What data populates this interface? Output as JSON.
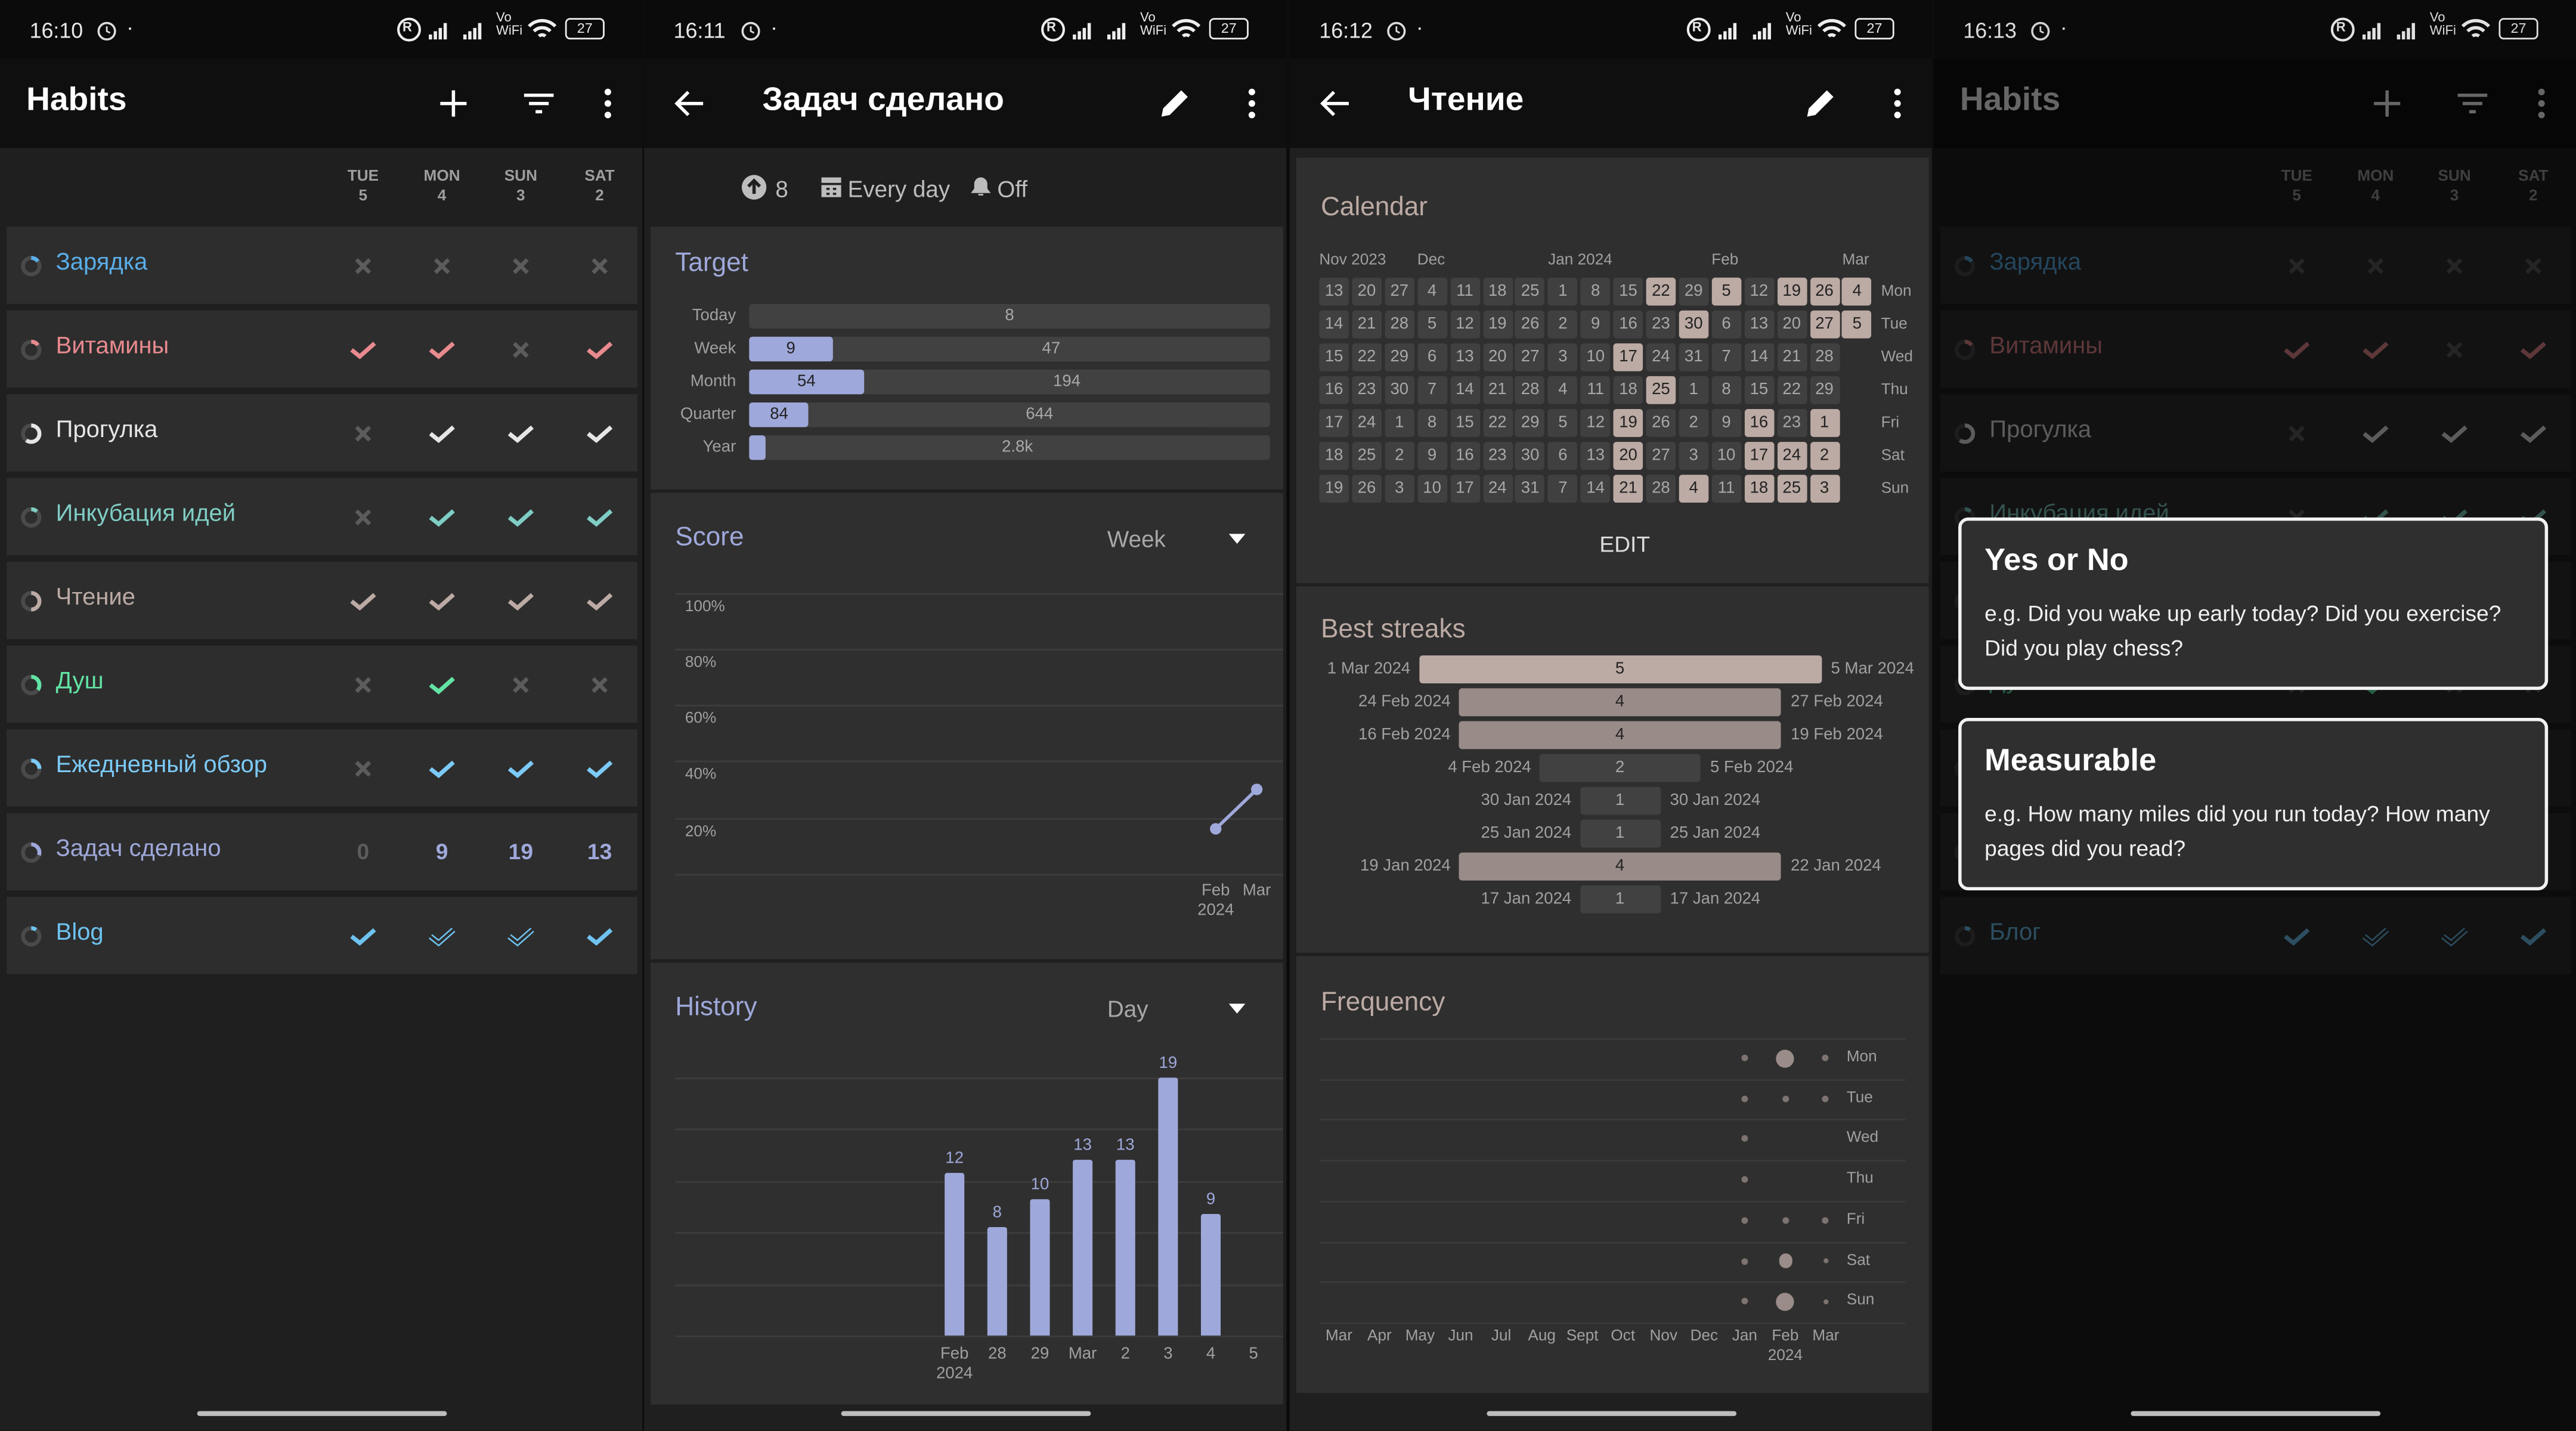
{
  "status_bars": [
    {
      "time": "16:10"
    },
    {
      "time": "16:11"
    },
    {
      "time": "16:12"
    },
    {
      "time": "16:13"
    }
  ],
  "status_icons": {
    "roaming": "R",
    "vo": "Vo",
    "wifi_label": "WiFi",
    "battery": "27"
  },
  "habits_screen": {
    "title": "Habits",
    "toolbar_icons": [
      "plus-icon",
      "filter-icon",
      "more-vert-icon"
    ],
    "day_headers": [
      {
        "dow": "TUE",
        "day": "5"
      },
      {
        "dow": "MON",
        "day": "4"
      },
      {
        "dow": "SUN",
        "day": "3"
      },
      {
        "dow": "SAT",
        "day": "2"
      }
    ],
    "habits": [
      {
        "name": "Зарядка",
        "color": "#5aaee8",
        "score": 0.15,
        "values": [
          "x",
          "x",
          "x",
          "x"
        ]
      },
      {
        "name": "Витамины",
        "color": "#e88a8f",
        "score": 0.15,
        "values": [
          "check",
          "check",
          "x",
          "check"
        ]
      },
      {
        "name": "Прогулка",
        "color": "#e6e6e6",
        "score": 0.6,
        "values": [
          "x",
          "check",
          "check",
          "check"
        ]
      },
      {
        "name": "Инкубация идей",
        "color": "#7fcdc4",
        "score": 0.12,
        "values": [
          "x",
          "check",
          "check",
          "check"
        ]
      },
      {
        "name": "Чтение",
        "color": "#bcaaa4",
        "score": 0.5,
        "values": [
          "check",
          "check",
          "check",
          "check"
        ]
      },
      {
        "name": "Душ",
        "color": "#62e3a4",
        "score": 0.35,
        "values": [
          "x",
          "check",
          "x",
          "x"
        ]
      },
      {
        "name": "Ежедневный обзор",
        "color": "#7ccaf7",
        "score": 0.25,
        "values": [
          "x",
          "check",
          "check",
          "check"
        ]
      },
      {
        "name": "Задач сделано",
        "color": "#9fa8da",
        "score": 0.3,
        "values": [
          "0",
          "9",
          "19",
          "13"
        ]
      },
      {
        "name": "Blog",
        "color": "#6ec3f0",
        "score": 0.1,
        "values": [
          "check",
          "check-outline",
          "check-outline",
          "check"
        ]
      }
    ]
  },
  "detail_screen": {
    "title": "Задач сделано",
    "accent": "#9fa8da",
    "subheader": {
      "target": "8",
      "frequency": "Every day",
      "reminder": "Off"
    },
    "target": {
      "title": "Target",
      "rows": [
        {
          "label": "Today",
          "done": "",
          "target": "8",
          "progress": 0.0
        },
        {
          "label": "Week",
          "done": "9",
          "target": "47",
          "progress": 0.16
        },
        {
          "label": "Month",
          "done": "54",
          "target": "194",
          "progress": 0.22
        },
        {
          "label": "Quarter",
          "done": "84",
          "target": "644",
          "progress": 0.115
        },
        {
          "label": "Year",
          "done": "",
          "target": "2.8k",
          "progress": 0.03
        }
      ]
    },
    "score_chart": {
      "title": "Score",
      "period": "Week",
      "chart_data": {
        "type": "line",
        "y_ticks": [
          "100%",
          "80%",
          "60%",
          "40%",
          "20%"
        ],
        "ylim": [
          0,
          100
        ],
        "x": [
          {
            "label": "Feb",
            "sub": "2024"
          },
          {
            "label": "Mar",
            "sub": ""
          }
        ],
        "values": [
          16,
          30
        ],
        "grid": true
      }
    },
    "history_chart": {
      "title": "History",
      "period": "Day",
      "chart_data": {
        "type": "bar",
        "categories": [
          {
            "label": "Feb",
            "sub": "2024"
          },
          {
            "label": "28",
            "sub": ""
          },
          {
            "label": "29",
            "sub": ""
          },
          {
            "label": "Mar",
            "sub": ""
          },
          {
            "label": "2",
            "sub": ""
          },
          {
            "label": "3",
            "sub": ""
          },
          {
            "label": "4",
            "sub": ""
          },
          {
            "label": "5",
            "sub": ""
          }
        ],
        "values": [
          12,
          8,
          10,
          13,
          13,
          19,
          9,
          null
        ],
        "ylim": [
          0,
          19
        ],
        "grid": true
      }
    }
  },
  "reading_screen": {
    "title": "Чтение",
    "accent": "#bcaaa4",
    "calendar": {
      "title": "Calendar",
      "edit_label": "EDIT",
      "weekdays": [
        "Mon",
        "Tue",
        "Wed",
        "Thu",
        "Fri",
        "Sat",
        "Sun"
      ],
      "month_labels": [
        {
          "label": "Nov 2023",
          "week": 0
        },
        {
          "label": "Dec",
          "week": 3
        },
        {
          "label": "Jan  2024",
          "week": 7
        },
        {
          "label": "Feb",
          "week": 12
        },
        {
          "label": "Mar",
          "week": 16
        }
      ],
      "weeks": [
        {
          "days": [
            13,
            14,
            15,
            16,
            17,
            18,
            19
          ],
          "checked": []
        },
        {
          "days": [
            20,
            21,
            22,
            23,
            24,
            25,
            26
          ],
          "checked": []
        },
        {
          "days": [
            27,
            28,
            29,
            30,
            1,
            2,
            3
          ],
          "checked": []
        },
        {
          "days": [
            4,
            5,
            6,
            7,
            8,
            9,
            10
          ],
          "checked": []
        },
        {
          "days": [
            11,
            12,
            13,
            14,
            15,
            16,
            17
          ],
          "checked": []
        },
        {
          "days": [
            18,
            19,
            20,
            21,
            22,
            23,
            24
          ],
          "checked": []
        },
        {
          "days": [
            25,
            26,
            27,
            28,
            29,
            30,
            31
          ],
          "checked": []
        },
        {
          "days": [
            1,
            2,
            3,
            4,
            5,
            6,
            7
          ],
          "checked": []
        },
        {
          "days": [
            8,
            9,
            10,
            11,
            12,
            13,
            14
          ],
          "checked": []
        },
        {
          "days": [
            15,
            16,
            17,
            18,
            19,
            20,
            21
          ],
          "checked": [
            17,
            19,
            20,
            21
          ]
        },
        {
          "days": [
            22,
            23,
            24,
            25,
            26,
            27,
            28
          ],
          "checked": [
            22,
            25
          ]
        },
        {
          "days": [
            29,
            30,
            31,
            1,
            2,
            3,
            4
          ],
          "checked": [
            30,
            4
          ]
        },
        {
          "days": [
            5,
            6,
            7,
            8,
            9,
            10,
            11
          ],
          "checked": [
            5
          ]
        },
        {
          "days": [
            12,
            13,
            14,
            15,
            16,
            17,
            18
          ],
          "checked": [
            16,
            17,
            18
          ]
        },
        {
          "days": [
            19,
            20,
            21,
            22,
            23,
            24,
            25
          ],
          "checked": [
            19,
            24,
            25
          ]
        },
        {
          "days": [
            26,
            27,
            28,
            29,
            1,
            2,
            3
          ],
          "checked": [
            26,
            27,
            1,
            2,
            3
          ]
        },
        {
          "days": [
            4,
            5
          ],
          "checked": [
            4,
            5
          ]
        }
      ]
    },
    "streaks": {
      "title": "Best streaks",
      "items": [
        {
          "start": "1 Mar 2024",
          "end": "5 Mar 2024",
          "length": 5
        },
        {
          "start": "24 Feb 2024",
          "end": "27 Feb 2024",
          "length": 4
        },
        {
          "start": "16 Feb 2024",
          "end": "19 Feb 2024",
          "length": 4
        },
        {
          "start": "4 Feb 2024",
          "end": "5 Feb 2024",
          "length": 2
        },
        {
          "start": "30 Jan 2024",
          "end": "30 Jan 2024",
          "length": 1
        },
        {
          "start": "25 Jan 2024",
          "end": "25 Jan 2024",
          "length": 1
        },
        {
          "start": "19 Jan 2024",
          "end": "22 Jan 2024",
          "length": 4
        },
        {
          "start": "17 Jan 2024",
          "end": "17 Jan 2024",
          "length": 1
        }
      ]
    },
    "frequency": {
      "title": "Frequency",
      "chart_data": {
        "type": "scatter",
        "months": [
          {
            "label": "Mar",
            "sub": ""
          },
          {
            "label": "Apr",
            "sub": ""
          },
          {
            "label": "May",
            "sub": ""
          },
          {
            "label": "Jun",
            "sub": ""
          },
          {
            "label": "Jul",
            "sub": ""
          },
          {
            "label": "Aug",
            "sub": ""
          },
          {
            "label": "Sept",
            "sub": ""
          },
          {
            "label": "Oct",
            "sub": ""
          },
          {
            "label": "Nov",
            "sub": ""
          },
          {
            "label": "Dec",
            "sub": ""
          },
          {
            "label": "Jan",
            "sub": ""
          },
          {
            "label": "Feb",
            "sub": "2024"
          },
          {
            "label": "Mar",
            "sub": ""
          }
        ],
        "weekdays": [
          "Mon",
          "Tue",
          "Wed",
          "Thu",
          "Fri",
          "Sat",
          "Sun"
        ],
        "counts": {
          "Mon": {
            "Jan": 1,
            "Feb": 3,
            "Mar": 1
          },
          "Tue": {
            "Jan": 1,
            "Feb": 1,
            "Mar": 1
          },
          "Wed": {
            "Jan": 1
          },
          "Thu": {
            "Jan": 1
          },
          "Fri": {
            "Jan": 1,
            "Feb": 1,
            "Mar": 1
          },
          "Sat": {
            "Jan": 1,
            "Feb": 2,
            "Mar": 1
          },
          "Sun": {
            "Jan": 1,
            "Feb": 3,
            "Mar": 1
          }
        }
      }
    }
  },
  "type_dialog_screen": {
    "title": "Habits",
    "habit_names": [
      "Зарядка",
      "Витамины",
      "Прогулка",
      "Инкубация идей",
      "Чтение",
      "Душ",
      "Ежедневный обзор",
      "Задач сделано",
      "Блог"
    ],
    "dialogs": [
      {
        "title": "Yes or No",
        "description": "e.g. Did you wake up early today? Did you exercise? Did you play chess?"
      },
      {
        "title": "Measurable",
        "description": "e.g. How many miles did you run today? How many pages did you read?"
      }
    ]
  }
}
